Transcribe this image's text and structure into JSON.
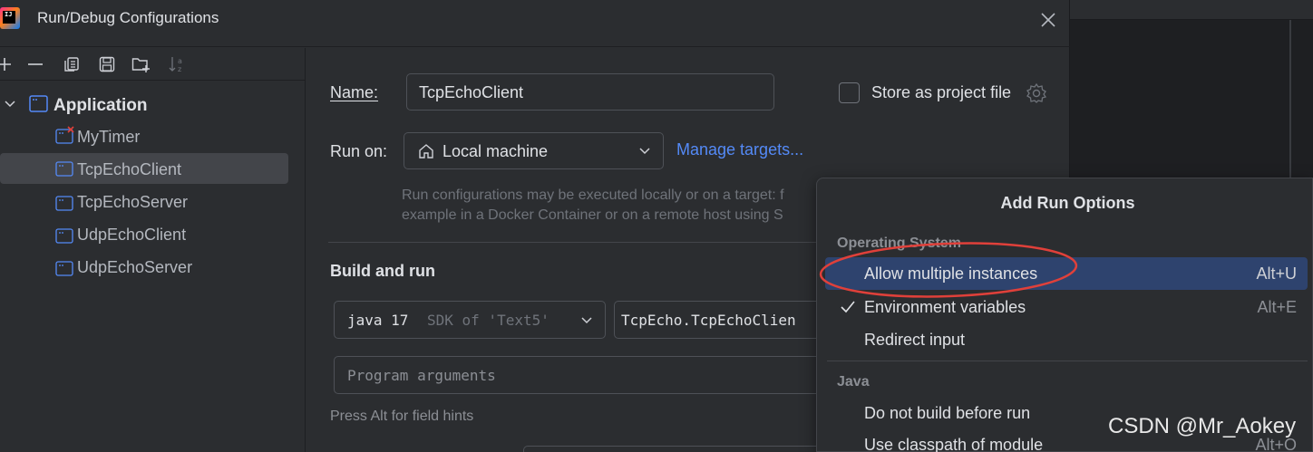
{
  "dialog": {
    "title": "Run/Debug Configurations",
    "app_logo_text": "IJ"
  },
  "tree": {
    "group_label": "Application",
    "items": [
      {
        "label": "MyTimer",
        "error": true
      },
      {
        "label": "TcpEchoClient",
        "selected": true
      },
      {
        "label": "TcpEchoServer"
      },
      {
        "label": "UdpEchoClient"
      },
      {
        "label": "UdpEchoServer"
      }
    ]
  },
  "toolbar": {
    "icons": [
      "add-icon",
      "remove-icon",
      "copy-icon",
      "save-icon",
      "new-folder-icon",
      "sort-icon"
    ]
  },
  "form": {
    "name_label": "Name:",
    "name_value": "TcpEchoClient",
    "store_label": "Store as project file",
    "run_on_label": "Run on:",
    "run_on_value": "Local machine",
    "manage_targets": "Manage targets...",
    "run_on_hint_1": "Run configurations may be executed locally or on a target: f",
    "run_on_hint_2": "example in a Docker Container or on a remote host using S",
    "build_and_run": "Build and run",
    "jdk_value": "java 17",
    "jdk_hint": "SDK of 'Text5'",
    "main_class": "TcpEcho.TcpEchoClien",
    "program_args_placeholder": "Program arguments",
    "field_hint": "Press Alt for field hints"
  },
  "popup": {
    "title": "Add Run Options",
    "sections": [
      {
        "title": "Operating System",
        "items": [
          {
            "label": "Allow multiple instances",
            "shortcut": "Alt+U",
            "highlighted": true,
            "checked": false
          },
          {
            "label": "Environment variables",
            "shortcut": "Alt+E",
            "highlighted": false,
            "checked": true
          },
          {
            "label": "Redirect input",
            "shortcut": "",
            "highlighted": false,
            "checked": false
          }
        ]
      },
      {
        "title": "Java",
        "items": [
          {
            "label": "Do not build before run",
            "shortcut": "",
            "highlighted": false,
            "checked": false
          },
          {
            "label": "Use classpath of module",
            "shortcut": "Alt+O",
            "highlighted": false,
            "checked": false
          }
        ]
      }
    ]
  },
  "colors": {
    "accent_link": "#548af7",
    "highlight": "#2e436e",
    "annotation": "#e0403a"
  },
  "watermark": "CSDN @Mr_Aokey"
}
